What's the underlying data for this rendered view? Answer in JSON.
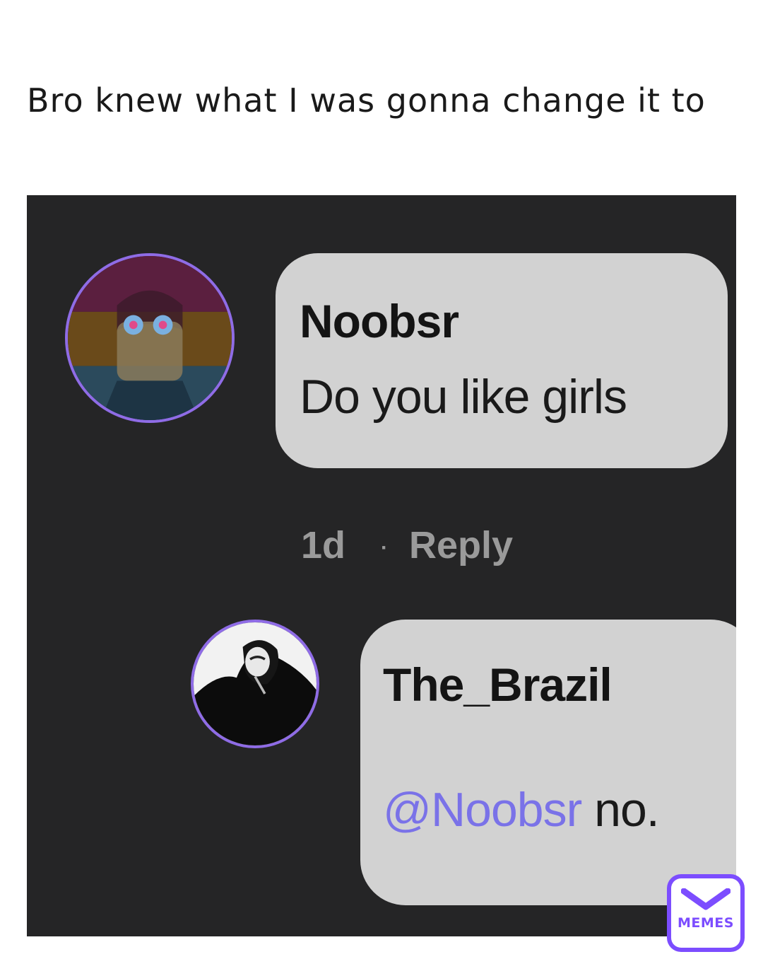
{
  "caption": "Bro knew what I was gonna change it to",
  "comments": [
    {
      "username": "Noobsr",
      "message": "Do you like girls",
      "avatar_icon": "user-avatar-pride-flag",
      "avatar_border_color": "#8f6ce6"
    },
    {
      "username": "The_Brazil",
      "mention": "@Noobsr",
      "message": " no.",
      "avatar_icon": "user-avatar-dark",
      "avatar_border_color": "#8f6ce6"
    }
  ],
  "meta": {
    "age": "1d",
    "separator": "·",
    "reply_label": "Reply"
  },
  "logo": {
    "text": "MEMES",
    "icon": "envelope-icon",
    "color": "#7c4dff"
  },
  "colors": {
    "background": "#252526",
    "bubble": "#d2d2d2",
    "mention": "#7a72e8",
    "meta_text": "#9a9a9a"
  }
}
